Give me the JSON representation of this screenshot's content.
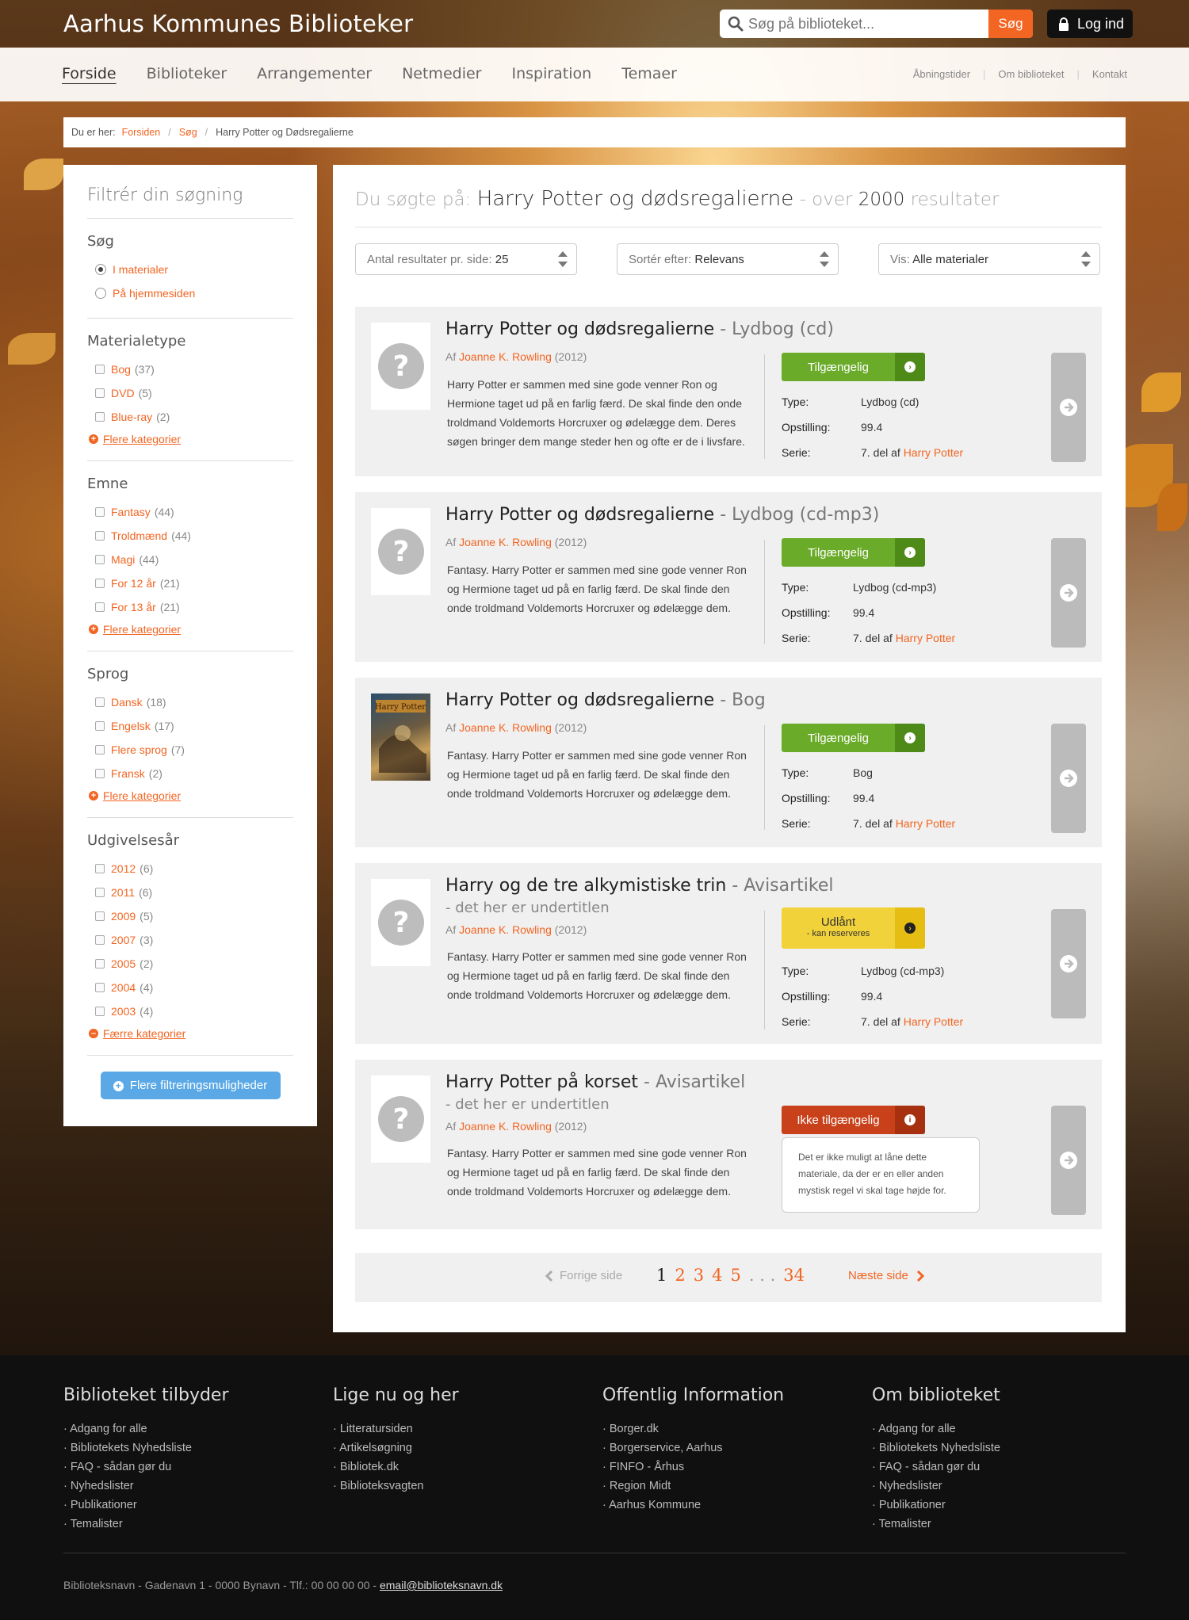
{
  "site": {
    "title": "Aarhus Kommunes Biblioteker"
  },
  "search": {
    "placeholder": "Søg på biblioteket...",
    "button": "Søg"
  },
  "login": {
    "label": "Log ind"
  },
  "nav": {
    "main": [
      "Forside",
      "Biblioteker",
      "Arrangementer",
      "Netmedier",
      "Inspiration",
      "Temaer"
    ],
    "util": [
      "Åbningstider",
      "Om biblioteket",
      "Kontakt"
    ]
  },
  "breadcrumb": {
    "label": "Du er her:",
    "items": [
      "Forsiden",
      "Søg"
    ],
    "current": "Harry Potter og Dødsregalierne"
  },
  "sidebar": {
    "title": "Filtrér din søgning",
    "search": {
      "heading": "Søg",
      "options": [
        "I materialer",
        "På hjemmesiden"
      ]
    },
    "materialetype": {
      "heading": "Materialetype",
      "items": [
        {
          "label": "Bog",
          "count": "(37)"
        },
        {
          "label": "DVD",
          "count": "(5)"
        },
        {
          "label": "Blue-ray",
          "count": "(2)"
        }
      ],
      "more": "Flere kategorier"
    },
    "emne": {
      "heading": "Emne",
      "items": [
        {
          "label": "Fantasy",
          "count": "(44)"
        },
        {
          "label": "Troldmænd",
          "count": "(44)"
        },
        {
          "label": "Magi",
          "count": "(44)"
        },
        {
          "label": "For 12 år",
          "count": "(21)"
        },
        {
          "label": "For 13 år",
          "count": "(21)"
        }
      ],
      "more": "Flere kategorier"
    },
    "sprog": {
      "heading": "Sprog",
      "items": [
        {
          "label": "Dansk",
          "count": "(18)"
        },
        {
          "label": "Engelsk",
          "count": "(17)"
        },
        {
          "label": "Flere sprog",
          "count": "(7)"
        },
        {
          "label": "Fransk",
          "count": "(2)"
        }
      ],
      "more": "Flere kategorier"
    },
    "udgivelsesaar": {
      "heading": "Udgivelsesår",
      "items": [
        {
          "label": "2012",
          "count": "(6)"
        },
        {
          "label": "2011",
          "count": "(6)"
        },
        {
          "label": "2009",
          "count": "(5)"
        },
        {
          "label": "2007",
          "count": "(3)"
        },
        {
          "label": "2005",
          "count": "(2)"
        },
        {
          "label": "2004",
          "count": "(4)"
        },
        {
          "label": "2003",
          "count": "(4)"
        }
      ],
      "less": "Færre kategorier"
    },
    "more_filters": "Flere filtreringsmuligheder"
  },
  "results": {
    "prefix": "Du søgte på:",
    "query": "Harry Potter og dødsregalierne",
    "mid": "- over",
    "count": "2000",
    "suffix": "resultater",
    "controls": [
      {
        "label": "Antal resultater pr. side:",
        "value": "25"
      },
      {
        "label": "Sortér efter:",
        "value": "Relevans"
      },
      {
        "label": "Vis:",
        "value": "Alle materialer"
      }
    ],
    "labels": {
      "by": "Af",
      "type": "Type:",
      "shelf": "Opstilling:",
      "series": "Serie:"
    },
    "items": [
      {
        "title": "Harry Potter og dødsregalierne",
        "format": "- Lydbog (cd)",
        "subtitle": "",
        "author": "Joanne K. Rowling",
        "year": "(2012)",
        "desc": "Harry Potter er sammen med sine gode venner Ron og Hermione taget ud på en farlig færd. De skal finde den onde troldmand Voldemorts Horcruxer og ødelægge dem. Deres søgen bringer dem mange steder hen og ofte er de i livsfare.",
        "status": "Tilgængelig",
        "status_sub": "",
        "type": "Lydbog (cd)",
        "shelf": "99.4",
        "series_pre": "7. del af",
        "series": "Harry Potter"
      },
      {
        "title": "Harry Potter og dødsregalierne",
        "format": "- Lydbog (cd-mp3)",
        "subtitle": "",
        "author": "Joanne K. Rowling",
        "year": "(2012)",
        "desc": "Fantasy. Harry Potter er sammen med sine gode venner Ron og Hermione taget ud på en farlig færd. De skal finde den onde troldmand Voldemorts Horcruxer og ødelægge dem.",
        "status": "Tilgængelig",
        "status_sub": "",
        "type": "Lydbog (cd-mp3)",
        "shelf": "99.4",
        "series_pre": "7. del af",
        "series": "Harry Potter"
      },
      {
        "title": "Harry Potter og dødsregalierne",
        "format": "- Bog",
        "subtitle": "",
        "author": "Joanne K. Rowling",
        "year": "(2012)",
        "desc": "Fantasy. Harry Potter er sammen med sine gode venner Ron og Hermione taget ud på en farlig færd. De skal finde den onde troldmand Voldemorts Horcruxer og ødelægge dem.",
        "status": "Tilgængelig",
        "status_sub": "",
        "type": "Bog",
        "shelf": "99.4",
        "series_pre": "7. del af",
        "series": "Harry Potter"
      },
      {
        "title": "Harry og de tre alkymistiske trin",
        "format": "- Avisartikel",
        "subtitle": "- det her er undertitlen",
        "author": "Joanne K. Rowling",
        "year": "(2012)",
        "desc": "Fantasy. Harry Potter er sammen med sine gode venner Ron og Hermione taget ud på en farlig færd. De skal finde den onde troldmand Voldemorts Horcruxer og ødelægge dem.",
        "status": "Udlånt",
        "status_sub": "- kan reserveres",
        "type": "Lydbog (cd-mp3)",
        "shelf": "99.4",
        "series_pre": "7. del af",
        "series": "Harry Potter"
      },
      {
        "title": "Harry Potter på korset",
        "format": "- Avisartikel",
        "subtitle": "- det her er undertitlen",
        "author": "Joanne K. Rowling",
        "year": "(2012)",
        "desc": "Fantasy. Harry Potter er sammen med sine gode venner Ron og Hermione taget ud på en farlig færd. De skal finde den onde troldmand Voldemorts Horcruxer og ødelægge dem.",
        "status": "Ikke tilgængelig",
        "status_sub": "",
        "tooltip": "Det er ikke muligt at låne dette materiale, da der er en eller anden mystisk regel vi skal tage højde for."
      }
    ]
  },
  "pagination": {
    "prev": "Forrige side",
    "pages": [
      "1",
      "2",
      "3",
      "4",
      "5"
    ],
    "dots": ". . .",
    "last": "34",
    "next": "Næste side"
  },
  "footer": {
    "cols": [
      {
        "title": "Biblioteket tilbyder",
        "items": [
          "Adgang for alle",
          "Bibliotekets Nyhedsliste",
          "FAQ - sådan gør du",
          "Nyhedslister",
          "Publikationer",
          "Temalister"
        ]
      },
      {
        "title": "Lige nu og her",
        "items": [
          "Litteratursiden",
          "Artikelsøgning",
          "Bibliotek.dk",
          "Biblioteksvagten"
        ]
      },
      {
        "title": "Offentlig Information",
        "items": [
          "Borger.dk",
          "Borgerservice, Aarhus",
          "FINFO - Århus",
          "Region Midt",
          "Aarhus Kommune"
        ]
      },
      {
        "title": "Om biblioteket",
        "items": [
          "Adgang for alle",
          "Bibliotekets Nyhedsliste",
          "FAQ - sådan gør du",
          "Nyhedslister",
          "Publikationer",
          "Temalister"
        ]
      }
    ],
    "address": "Biblioteksnavn - Gadenavn 1 - 0000 Bynavn - Tlf.: 00 00 00 00 -",
    "email": "email@biblioteksnavn.dk"
  },
  "colors": {
    "accent": "#f26522",
    "available": "#6bab2a",
    "loaned": "#f2d23b",
    "unavailable": "#c9411a",
    "filter_button": "#5aa9e6"
  }
}
